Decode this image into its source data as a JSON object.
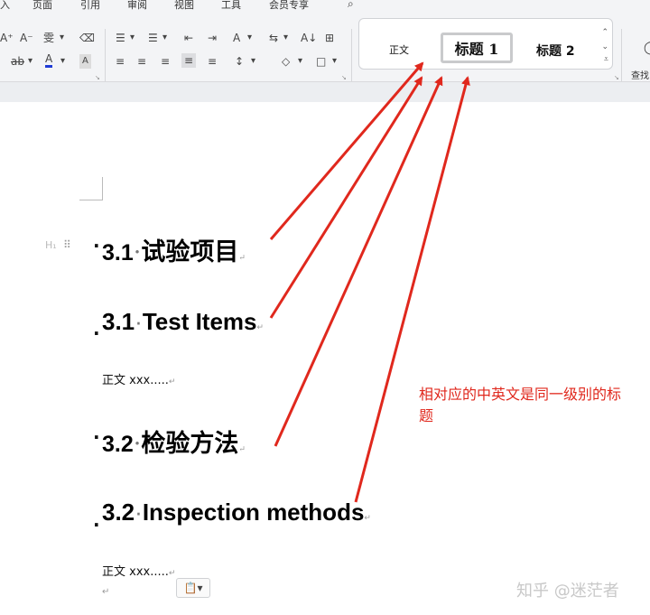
{
  "menubar": {
    "items": [
      "入",
      "页面",
      "引用",
      "审阅",
      "视图",
      "工具",
      "会员专享"
    ],
    "search_icon": "search-icon"
  },
  "ribbon": {
    "font_group": {
      "row1": [
        "A⁺",
        "A⁻",
        "雯",
        "⌫"
      ],
      "row2": [
        "ab",
        "A",
        "A"
      ],
      "font_color": "#1f3bd6"
    },
    "paragraph_group": {
      "row1": [
        "☰",
        "☰",
        "⇤",
        "⇥",
        "A",
        "⇆",
        "A↓",
        "⊞"
      ],
      "row2": [
        "≡",
        "≡",
        "≡",
        "≡",
        "≡",
        "↕",
        "◇",
        "□"
      ]
    },
    "styles": {
      "normal": "正文",
      "heading1": "标题 1",
      "heading2": "标题 2"
    },
    "find_label": "查找"
  },
  "document": {
    "headings": [
      {
        "number": "3.1",
        "text": "试验项目",
        "lang": "cn"
      },
      {
        "number": "3.1",
        "text": "Test Items",
        "lang": "en"
      },
      {
        "number": "3.2",
        "text": "检验方法",
        "lang": "cn"
      },
      {
        "number": "3.2",
        "text": "Inspection methods",
        "lang": "en"
      }
    ],
    "body_paragraphs": [
      "正文 xxx.....",
      "正文 xxx....."
    ],
    "heading_marker": "H₁",
    "paragraph_mark": "↵"
  },
  "annotation": {
    "text": "相对应的中英文是同一级别的标题",
    "color": "#e0281d"
  },
  "arrow_color": "#e0281d",
  "watermark": "知乎 @迷茫者"
}
